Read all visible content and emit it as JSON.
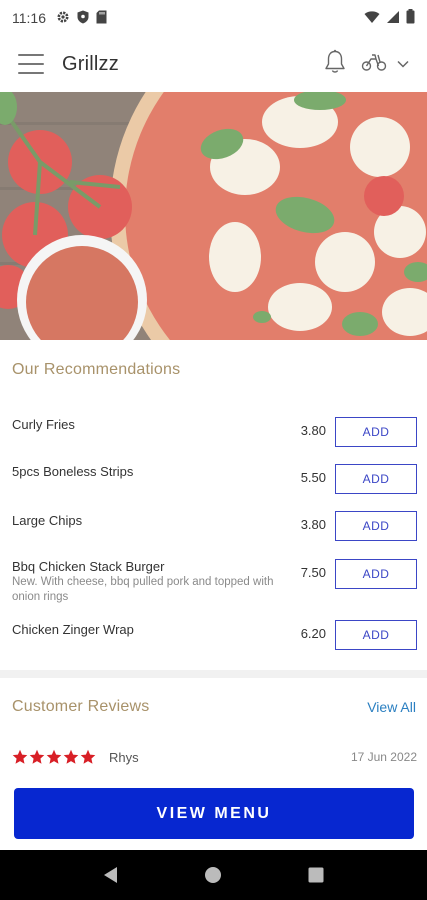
{
  "status_bar": {
    "time": "11:16"
  },
  "app_bar": {
    "title": "Grillzz"
  },
  "recommendations": {
    "title": "Our Recommendations",
    "items": [
      {
        "name": "Curly Fries",
        "description": "",
        "price": "3.80",
        "button": "ADD"
      },
      {
        "name": "5pcs Boneless Strips",
        "description": "",
        "price": "5.50",
        "button": "ADD"
      },
      {
        "name": "Large Chips",
        "description": "",
        "price": "3.80",
        "button": "ADD"
      },
      {
        "name": "Bbq Chicken Stack Burger",
        "description": "New. With cheese, bbq pulled pork and topped with onion rings",
        "price": "7.50",
        "button": "ADD"
      },
      {
        "name": "Chicken Zinger Wrap",
        "description": "",
        "price": "6.20",
        "button": "ADD"
      }
    ]
  },
  "reviews": {
    "title": "Customer Reviews",
    "view_all": "View All",
    "items": [
      {
        "rating": 5,
        "name": "Rhys",
        "date": "17 Jun 2022"
      }
    ]
  },
  "view_menu_label": "VIEW MENU",
  "colors": {
    "accent": "#0727d0",
    "add_border": "#3b46c6",
    "section_title": "#a8926a",
    "link": "#2a7fc1",
    "star": "#d81f26"
  }
}
